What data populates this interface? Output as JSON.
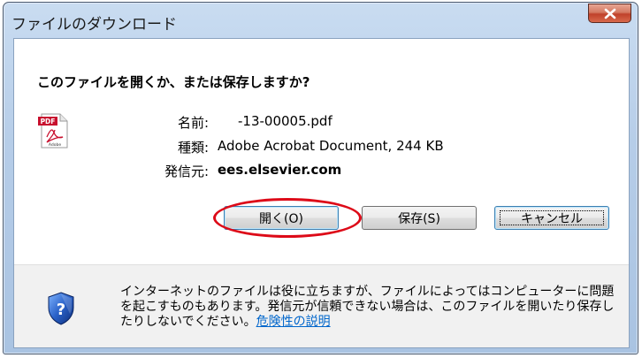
{
  "window": {
    "title": "ファイルのダウンロード",
    "question": "このファイルを開くか、または保存しますか?"
  },
  "file": {
    "name_label": "名前:",
    "name_value": "-13-00005.pdf",
    "type_label": "種類:",
    "type_value": "Adobe Acrobat Document, 244 KB",
    "from_label": "発信元:",
    "from_value": "ees.elsevier.com",
    "icon": "pdf-file-icon",
    "icon_text": "PDF",
    "icon_subtext": "Adobe"
  },
  "buttons": {
    "open": "開く(O)",
    "save": "保存(S)",
    "cancel": "キャンセル"
  },
  "footer": {
    "warning_text": "インターネットのファイルは役に立ちますが、ファイルによってはコンピューターに問題を起こすものもあります。発信元が信頼できない場合は、このファイルを開いたり保存したりしないでください。",
    "link_text": "危険性の説明",
    "icon": "shield-question-icon"
  },
  "colors": {
    "highlight": "#dd0a18",
    "link": "#0066cc",
    "close": "#c0412a"
  }
}
